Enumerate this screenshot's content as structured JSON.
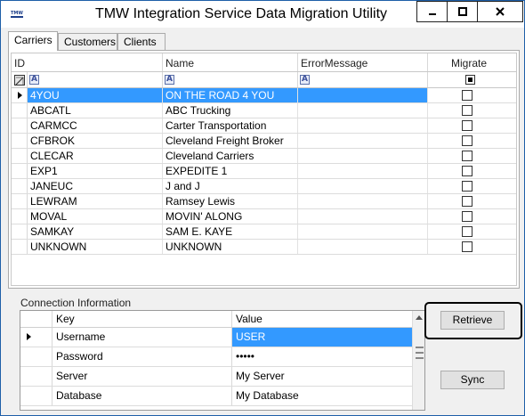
{
  "window": {
    "title": "TMW Integration Service Data Migration Utility",
    "app_icon_text": "TMW"
  },
  "tabs": [
    {
      "label": "Carriers",
      "active": true
    },
    {
      "label": "Customers",
      "active": false
    },
    {
      "label": "Clients",
      "active": false
    }
  ],
  "grid": {
    "columns": [
      "ID",
      "Name",
      "ErrorMessage",
      "Migrate"
    ],
    "filter_glyph": "A",
    "rows": [
      {
        "id": "4YOU",
        "name": "ON THE ROAD 4 YOU",
        "error": "",
        "migrate": false,
        "selected": true
      },
      {
        "id": "ABCATL",
        "name": "ABC Trucking",
        "error": "",
        "migrate": false
      },
      {
        "id": "CARMCC",
        "name": "Carter Transportation",
        "error": "",
        "migrate": false
      },
      {
        "id": "CFBROK",
        "name": "Cleveland Freight Broker",
        "error": "",
        "migrate": false
      },
      {
        "id": "CLECAR",
        "name": "Cleveland Carriers",
        "error": "",
        "migrate": false
      },
      {
        "id": "EXP1",
        "name": "EXPEDITE 1",
        "error": "",
        "migrate": false
      },
      {
        "id": "JANEUC",
        "name": "J and J",
        "error": "",
        "migrate": false
      },
      {
        "id": "LEWRAM",
        "name": "Ramsey Lewis",
        "error": "",
        "migrate": false
      },
      {
        "id": "MOVAL",
        "name": "MOVIN' ALONG",
        "error": "",
        "migrate": false
      },
      {
        "id": "SAMKAY",
        "name": "SAM E. KAYE",
        "error": "",
        "migrate": false
      },
      {
        "id": "UNKNOWN",
        "name": "UNKNOWN",
        "error": "",
        "migrate": false
      }
    ]
  },
  "connection": {
    "label": "Connection Information",
    "headers": [
      "Key",
      "Value"
    ],
    "rows": [
      {
        "key": "Username",
        "value": "USER",
        "selected": true
      },
      {
        "key": "Password",
        "value": "•••••"
      },
      {
        "key": "Server",
        "value": "My Server"
      },
      {
        "key": "Database",
        "value": "My Database"
      }
    ]
  },
  "buttons": {
    "retrieve": "Retrieve",
    "sync": "Sync"
  },
  "colors": {
    "selection": "#3399ff",
    "title_border": "#1e5fa8",
    "button_face": "#e1e1e1"
  }
}
